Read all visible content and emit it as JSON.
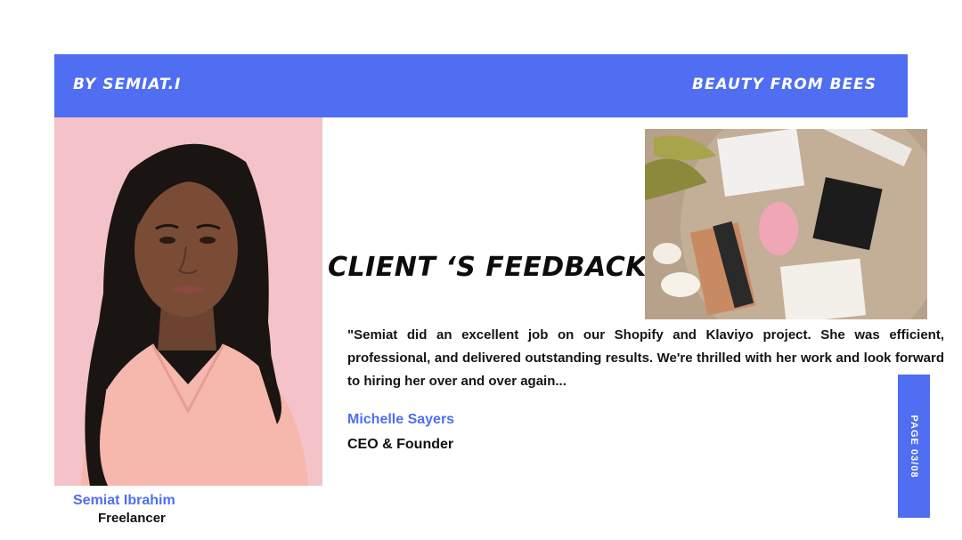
{
  "header": {
    "left_text": "BY SEMIAT.I",
    "right_text": "BEAUTY FROM BEES"
  },
  "freelancer": {
    "name": "Semiat Ibrahim",
    "role": "Freelancer"
  },
  "section_title": "CLIENT ‘S FEEDBACK",
  "testimonial": {
    "quote": "\"Semiat did an excellent job on our Shopify and Klaviyo project. She was efficient, professional, and delivered outstanding results. We're thrilled with her work and look forward to hiring her over and over again...",
    "client_name": "Michelle Sayers",
    "client_role": "CEO & Founder"
  },
  "page_indicator": "PAGE 03/08",
  "colors": {
    "accent": "#4f6ef2",
    "portrait_bg": "#f4c3c9",
    "text": "#111111"
  }
}
